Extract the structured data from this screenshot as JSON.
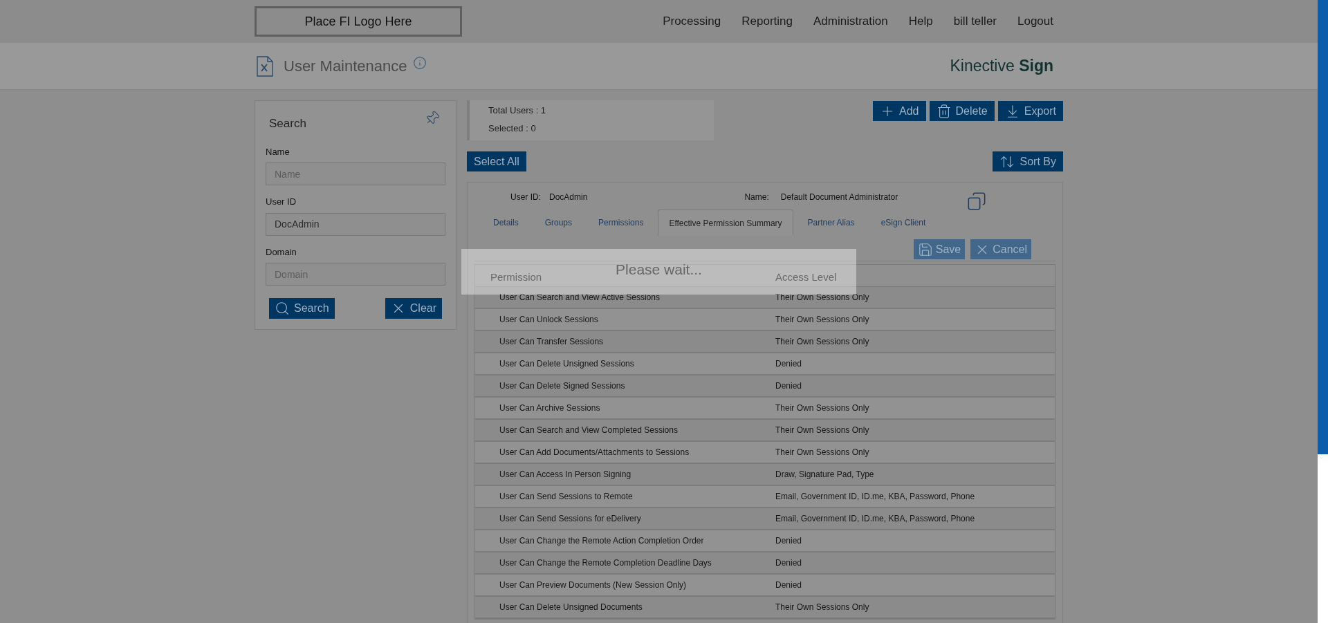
{
  "header": {
    "logo": "Place FI Logo Here",
    "menu": [
      "Processing",
      "Reporting",
      "Administration",
      "Help",
      "bill teller",
      "Logout"
    ]
  },
  "subheader": {
    "title": "User Maintenance",
    "brand": "Kinective **Sign**"
  },
  "search_panel": {
    "title": "Search",
    "fields": [
      {
        "label": "Name",
        "placeholder": "Name"
      },
      {
        "label": "User ID",
        "value": "DocAdmin"
      },
      {
        "label": "Domain",
        "placeholder": "Domain"
      }
    ],
    "buttons": [
      {
        "kind": "search",
        "label": "Search"
      },
      {
        "kind": "clear",
        "label": "Clear"
      }
    ]
  },
  "summary": [
    "Total Users : 1",
    "Selected : 0"
  ],
  "actions": [
    {
      "kind": "add",
      "label": "Add"
    },
    {
      "kind": "delete",
      "label": "Delete"
    },
    {
      "kind": "export",
      "label": "Export"
    }
  ],
  "select_all": "Select All",
  "sort_by": "Sort By",
  "user_card": {
    "user_id_label": "User ID:",
    "user_id": "DocAdmin",
    "name_label": "Name:",
    "name": "Default Document Administrator"
  },
  "tabs": [
    {
      "label": "Details",
      "selected": false
    },
    {
      "label": "Groups",
      "selected": false
    },
    {
      "label": "Permissions",
      "selected": false
    },
    {
      "label": "Effective Permission Summary",
      "selected": true
    },
    {
      "label": "Partner Alias",
      "selected": false
    },
    {
      "label": "eSign Client",
      "selected": false
    }
  ],
  "form_buttons": [
    {
      "kind": "save",
      "label": "Save",
      "disabled": true
    },
    {
      "kind": "cancel",
      "label": "Cancel",
      "disabled": true
    }
  ],
  "table": {
    "columns": [
      "Permission",
      "Access Level"
    ],
    "rows": [
      [
        "User Can Search and View Active Sessions",
        "Their Own Sessions Only"
      ],
      [
        "User Can Unlock Sessions",
        "Their Own Sessions Only"
      ],
      [
        "User Can Transfer Sessions",
        "Their Own Sessions Only"
      ],
      [
        "User Can Delete Unsigned Sessions",
        "Denied"
      ],
      [
        "User Can Delete Signed Sessions",
        "Denied"
      ],
      [
        "User Can Archive Sessions",
        "Their Own Sessions Only"
      ],
      [
        "User Can Search and View Completed Sessions",
        "Their Own Sessions Only"
      ],
      [
        "User Can Add Documents/Attachments to Sessions",
        "Their Own Sessions Only"
      ],
      [
        "User Can Access In Person Signing",
        "Draw, Signature Pad, Type"
      ],
      [
        "User Can Send Sessions to Remote",
        "Email, Government ID, ID.me, KBA, Password, Phone"
      ],
      [
        "User Can Send Sessions for eDelivery",
        "Email, Government ID, ID.me, KBA, Password, Phone"
      ],
      [
        "User Can Change the Remote Action Completion Order",
        "Denied"
      ],
      [
        "User Can Change the Remote Completion Deadline Days",
        "Denied"
      ],
      [
        "User Can Preview Documents (New Session Only)",
        "Denied"
      ],
      [
        "User Can Delete Unsigned Documents",
        "Their Own Sessions Only"
      ]
    ]
  },
  "loading": {
    "message": "Please wait..."
  }
}
